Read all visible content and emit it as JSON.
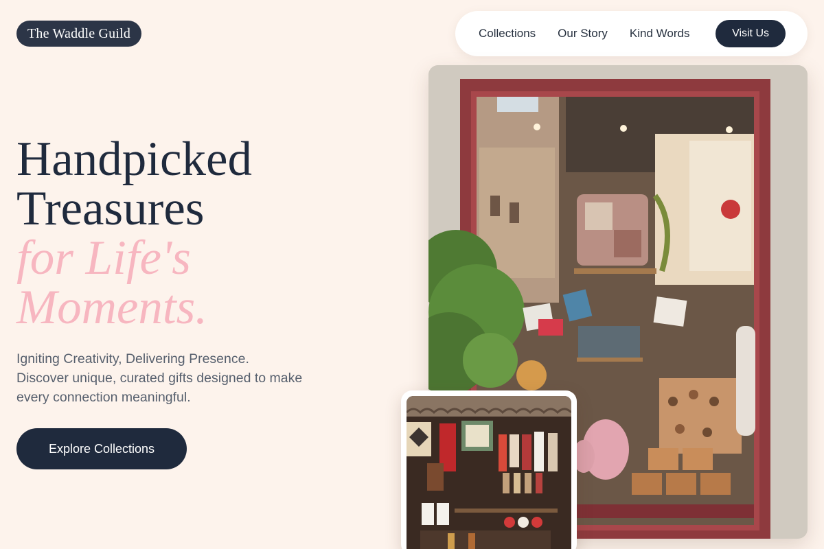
{
  "brand": {
    "name": "The Waddle Guild"
  },
  "nav": {
    "links": [
      "Collections",
      "Our Story",
      "Kind Words"
    ],
    "cta": "Visit Us"
  },
  "hero": {
    "title_line1": "Handpicked",
    "title_line2": "Treasures",
    "accent_line1": "for Life's",
    "accent_line2": "Moments.",
    "subtitle": "Igniting Creativity, Delivering Presence. Discover unique, curated gifts designed to make every connection meaningful.",
    "cta": "Explore Collections"
  },
  "images": {
    "main": "storefront-window-photo",
    "secondary": "market-stall-photo"
  },
  "colors": {
    "background": "#fdf3ec",
    "primary": "#1f2a3d",
    "accent": "#f7b6c0",
    "muted_text": "#565f6d"
  }
}
